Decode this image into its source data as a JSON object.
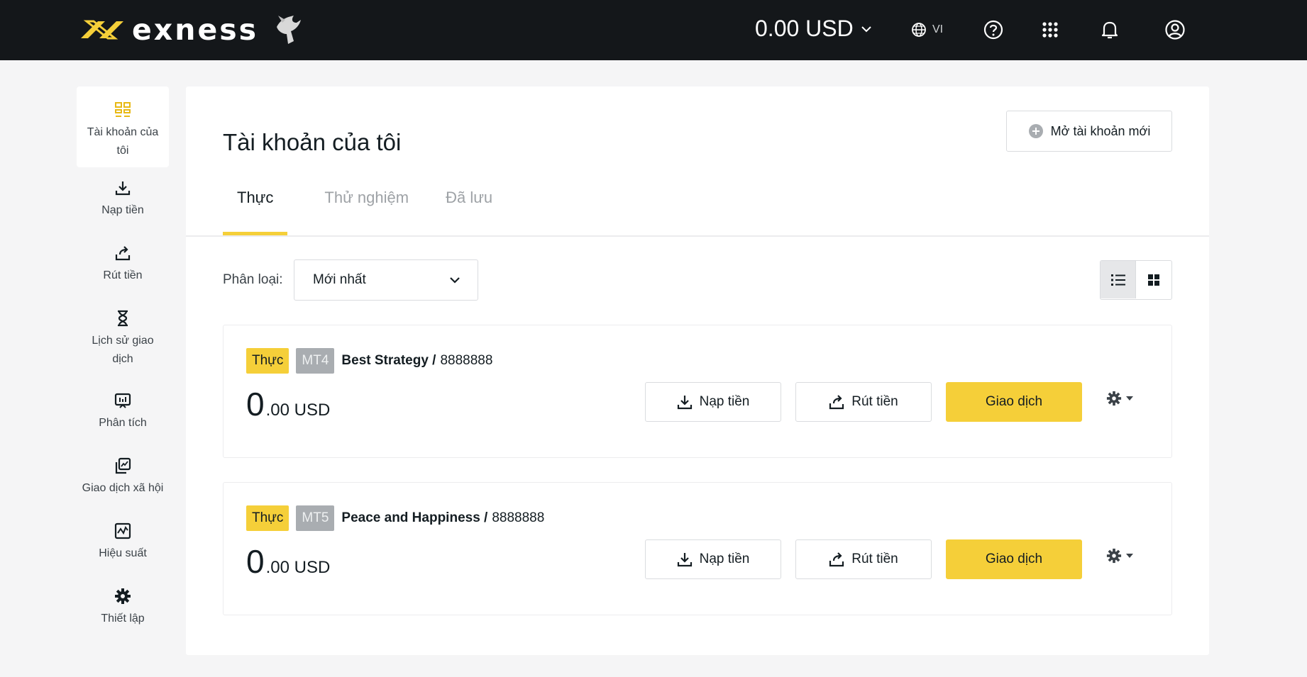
{
  "header": {
    "logo_text": "exness",
    "balance": "0.00 USD",
    "language": "VI"
  },
  "sidebar": {
    "items": [
      {
        "label": "Tài khoản của tôi",
        "icon": "accounts-grid-icon"
      },
      {
        "label": "Nạp tiền",
        "icon": "download-icon"
      },
      {
        "label": "Rút tiền",
        "icon": "upload-share-icon"
      },
      {
        "label": "Lịch sử giao dịch",
        "icon": "hourglass-icon"
      },
      {
        "label": "Phân tích",
        "icon": "analytics-icon"
      },
      {
        "label": "Giao dịch xã hội",
        "icon": "social-trading-icon"
      },
      {
        "label": "Hiệu suất",
        "icon": "performance-icon"
      },
      {
        "label": "Thiết lập",
        "icon": "gear-icon"
      }
    ]
  },
  "main": {
    "title": "Tài khoản của tôi",
    "new_account_label": "Mở tài khoản mới",
    "tabs": [
      {
        "label": "Thực",
        "active": true
      },
      {
        "label": "Thử nghiệm",
        "active": false
      },
      {
        "label": "Đã lưu",
        "active": false
      }
    ],
    "sort_label": "Phân loại:",
    "sort_value": "Mới nhất"
  },
  "accounts": [
    {
      "type_badge": "Thực",
      "platform": "MT4",
      "name": "Best Strategy /",
      "number": "8888888",
      "amount_int": "0",
      "amount_rest": ".00 USD",
      "deposit_label": "Nạp tiền",
      "withdraw_label": "Rút tiền",
      "trade_label": "Giao dịch"
    },
    {
      "type_badge": "Thực",
      "platform": "MT5",
      "name": "Peace and Happiness /",
      "number": "8888888",
      "amount_int": "0",
      "amount_rest": ".00 USD",
      "deposit_label": "Nạp tiền",
      "withdraw_label": "Rút tiền",
      "trade_label": "Giao dịch"
    }
  ],
  "colors": {
    "topbar": "#14171a",
    "accent": "#f5cf39",
    "page_bg": "#f5f5f6"
  }
}
